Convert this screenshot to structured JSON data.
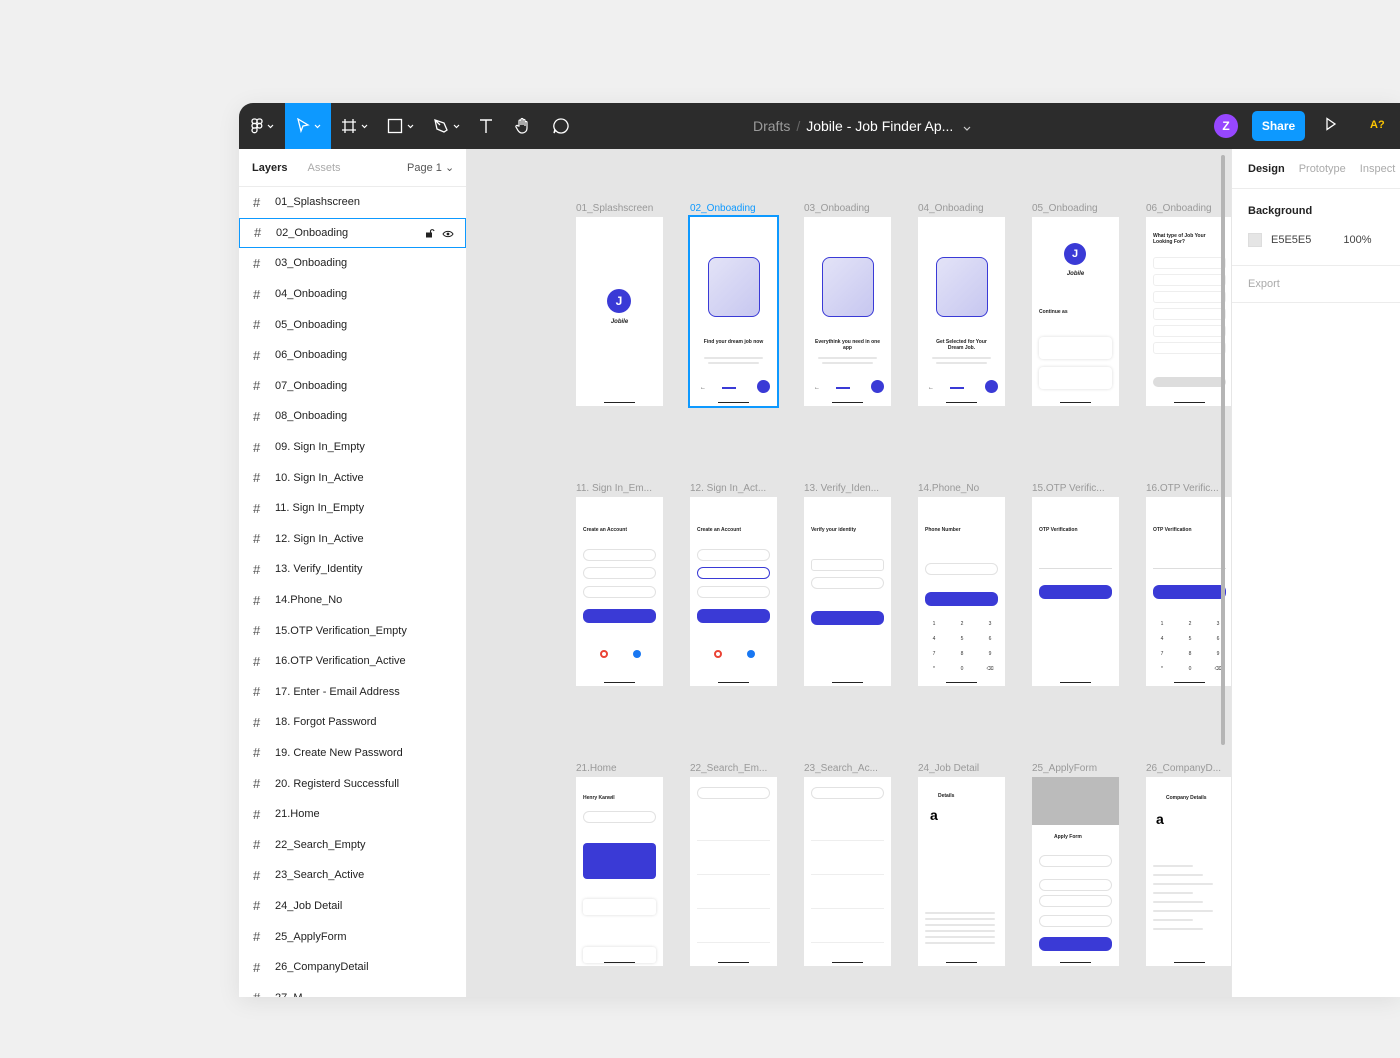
{
  "toolbar": {
    "breadcrumb_drafts": "Drafts",
    "breadcrumb_sep": "/",
    "file_name": "Jobile - Job Finder Ap...",
    "avatar_initial": "Z",
    "share_label": "Share",
    "font_ai": "A?"
  },
  "left_panel": {
    "tab_layers": "Layers",
    "tab_assets": "Assets",
    "page": "Page 1",
    "layers": [
      "01_Splashscreen",
      "02_Onboading",
      "03_Onboading",
      "04_Onboading",
      "05_Onboading",
      "06_Onboading",
      "07_Onboading",
      "08_Onboading",
      "09. Sign In_Empty",
      "10. Sign In_Active",
      "11. Sign In_Empty",
      "12. Sign In_Active",
      "13. Verify_Identity",
      "14.Phone_No",
      "15.OTP Verification_Empty",
      "16.OTP Verification_Active",
      "17. Enter - Email Address",
      "18. Forgot Password",
      "19. Create New Password",
      "20. Registerd Successfull",
      "21.Home",
      "22_Search_Empty",
      "23_Search_Active",
      "24_Job Detail",
      "25_ApplyForm",
      "26_CompanyDetail",
      "27_M..."
    ]
  },
  "right_panel": {
    "tab_design": "Design",
    "tab_prototype": "Prototype",
    "tab_inspect": "Inspect",
    "background_label": "Background",
    "background_hex": "E5E5E5",
    "background_opacity": "100%",
    "export_label": "Export",
    "swatch_color": "#e5e5e5"
  },
  "canvas": {
    "row1_labels": [
      "01_Splashscreen",
      "02_Onboading",
      "03_Onboading",
      "04_Onboading",
      "05_Onboading",
      "06_Onboading"
    ],
    "row2_labels": [
      "11. Sign In_Em...",
      "12. Sign In_Act...",
      "13. Verify_Iden...",
      "14.Phone_No",
      "15.OTP Verific...",
      "16.OTP Verific..."
    ],
    "row3_labels": [
      "21.Home",
      "22_Search_Em...",
      "23_Search_Ac...",
      "24_Job Detail",
      "25_ApplyForm",
      "26_CompanyD..."
    ],
    "screens": {
      "splash_brand": "Jobile",
      "splash_logo": "J",
      "onb2_text": "Find your dream job now",
      "onb3_text": "Everythink you need in one app",
      "onb4_text": "Get Selected for Your Dream Job.",
      "onb5_brand": "Jobile",
      "onb5_continue": "Continue as",
      "onb6_title": "What type of Job Your Looking For?",
      "signin_title": "Create an Account",
      "verify_title": "Verify your identity",
      "phone_title": "Phone Number",
      "otp_title": "OTP Verification",
      "home_greeting": "Henry Kanwil",
      "details_title": "Details",
      "apply_title": "Apply Form",
      "company_title": "Company Details",
      "company_logo": "a"
    }
  },
  "colors": {
    "accent": "#0d99ff",
    "brand": "#3a3ad6",
    "avatar": "#9747ff"
  }
}
